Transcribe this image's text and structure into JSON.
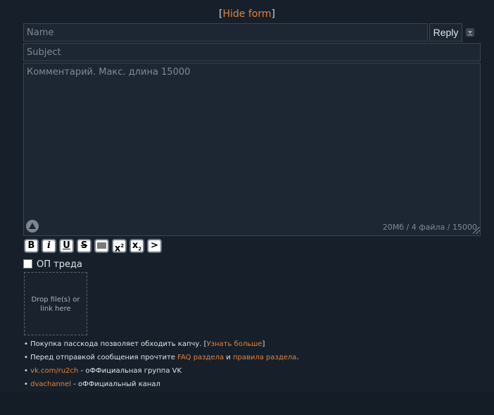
{
  "header": {
    "bracket_open": "[",
    "hide_form_label": "Hide form",
    "bracket_close": "]"
  },
  "form": {
    "name_placeholder": "Name",
    "reply_label": "Reply",
    "subject_placeholder": "Subject",
    "comment_placeholder": "Комментарий. Макс. длина 15000",
    "counter": "20Мб / 4 файла / 15000",
    "op_label": "ОП треда",
    "dropzone_text": "Drop file(s) or link here"
  },
  "formatting": {
    "bold": "B",
    "italic": "i",
    "underline": "U",
    "strike": "S",
    "sup": "x",
    "sup_mark": "2",
    "sub": "x",
    "sub_mark": "2",
    "quote": ">"
  },
  "rules": [
    {
      "bullet": "•",
      "prefix": "Покупка пасскода позволяет обходить капчу. [",
      "link": "Узнать больше",
      "suffix": "]"
    },
    {
      "bullet": "•",
      "prefix": "Перед отправкой сообщения прочтите ",
      "link1": "FAQ раздела",
      "middle": " и ",
      "link2": "правила раздела",
      "suffix": "."
    },
    {
      "bullet": "•",
      "link": "vk.com/ru2ch",
      "suffix": " - оФФициальная группа VK"
    },
    {
      "bullet": "•",
      "link": "dvachannel",
      "suffix": " - оФФициальный канал"
    }
  ],
  "colors": {
    "background": "#17202a",
    "field": "#1c2733",
    "accent": "#e0823d",
    "text": "#c9d1d9"
  }
}
